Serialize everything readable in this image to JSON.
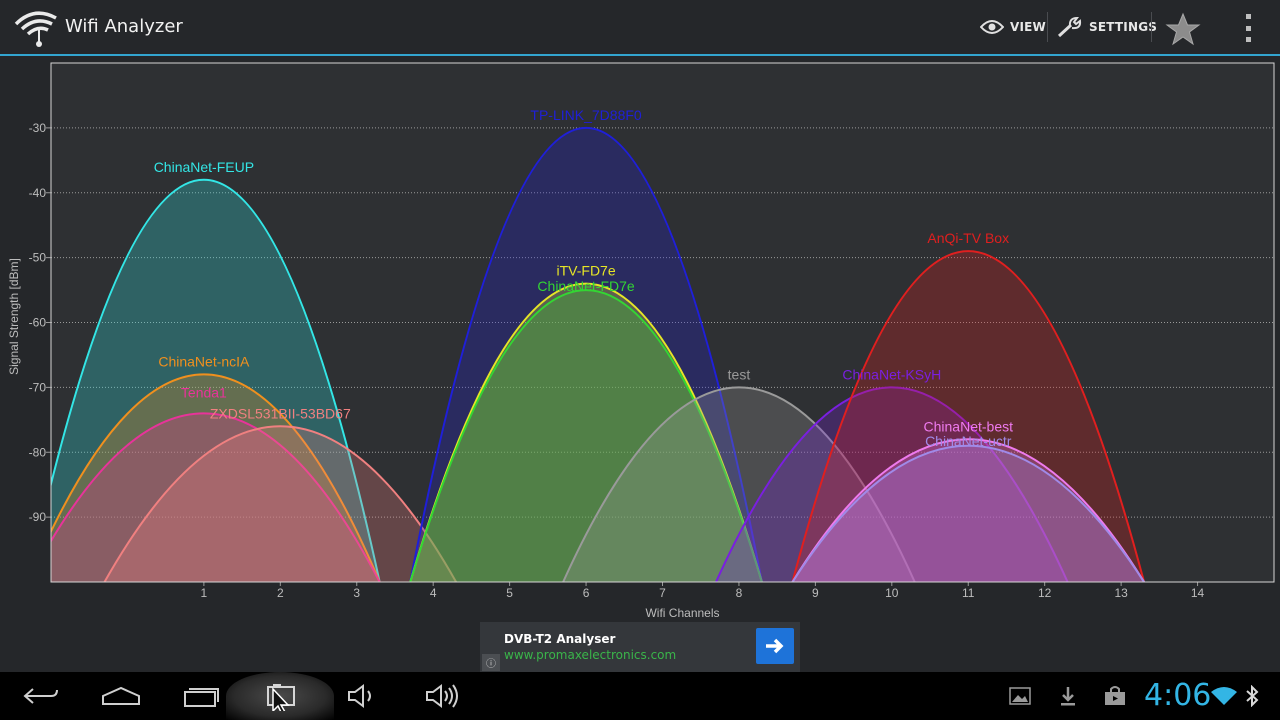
{
  "app": {
    "title": "Wifi Analyzer",
    "actions": [
      {
        "label": "VIEW",
        "icon": "eye-icon"
      },
      {
        "label": "SETTINGS",
        "icon": "wrench-icon"
      }
    ],
    "star_icon": "star-icon",
    "overflow_icon": "overflow-menu-icon"
  },
  "chart_data": {
    "type": "area",
    "xlabel": "Wifi Channels",
    "ylabel": "Signal Strength [dBm]",
    "xlim": [
      -1,
      15
    ],
    "ylim": [
      -100,
      -20
    ],
    "x_ticks": [
      1,
      2,
      3,
      4,
      5,
      6,
      7,
      8,
      9,
      10,
      11,
      12,
      13,
      14
    ],
    "y_ticks": [
      -30,
      -40,
      -50,
      -60,
      -70,
      -80,
      -90
    ],
    "grid": "horizontal-dotted",
    "series": [
      {
        "name": "ChinaNet-FEUP",
        "channel": 1,
        "dbm": -38,
        "color": "#33e6e6"
      },
      {
        "name": "ChinaNet-ncIA",
        "channel": 1,
        "dbm": -68,
        "color": "#f0901e"
      },
      {
        "name": "Tenda1",
        "channel": 1,
        "dbm": -74,
        "color": "#e8339a"
      },
      {
        "name": "ZXDSL531BII-53BD67",
        "channel": 2,
        "dbm": -76,
        "color": "#f08080"
      },
      {
        "name": "TP-LINK_7D88F0",
        "channel": 6,
        "dbm": -30,
        "color": "#1f1fd9"
      },
      {
        "name": "iTV-FD7e",
        "channel": 6,
        "dbm": -54,
        "color": "#e6e626"
      },
      {
        "name": "ChinaNet-FD7e",
        "channel": 6,
        "dbm": -55,
        "color": "#33d633"
      },
      {
        "name": "test",
        "channel": 8,
        "dbm": -70,
        "color": "#9a9a9a"
      },
      {
        "name": "ChinaNet-KSyH",
        "channel": 10,
        "dbm": -70,
        "color": "#7a1fe0"
      },
      {
        "name": "AnQi-TV Box",
        "channel": 11,
        "dbm": -49,
        "color": "#e01f1f"
      },
      {
        "name": "ChinaNet-best",
        "channel": 11,
        "dbm": -78,
        "color": "#ee7aee"
      },
      {
        "name": "ChinaNet-uctr",
        "channel": 11,
        "dbm": -79,
        "color": "#a08ae8"
      }
    ]
  },
  "ad": {
    "title": "DVB-T2 Analyser",
    "url": "www.promaxelectronics.com",
    "info": "ⓘ"
  },
  "navbar": {
    "buttons": [
      "back-icon",
      "home-icon",
      "recent-apps-icon",
      "screenshot-icon",
      "volume-down-icon",
      "volume-up-icon"
    ],
    "status_icons": [
      "gallery-notification-icon",
      "download-notification-icon",
      "store-notification-icon",
      "wifi-signal-icon",
      "bluetooth-icon"
    ],
    "time": "4:06",
    "accent": "#33b5e5"
  }
}
